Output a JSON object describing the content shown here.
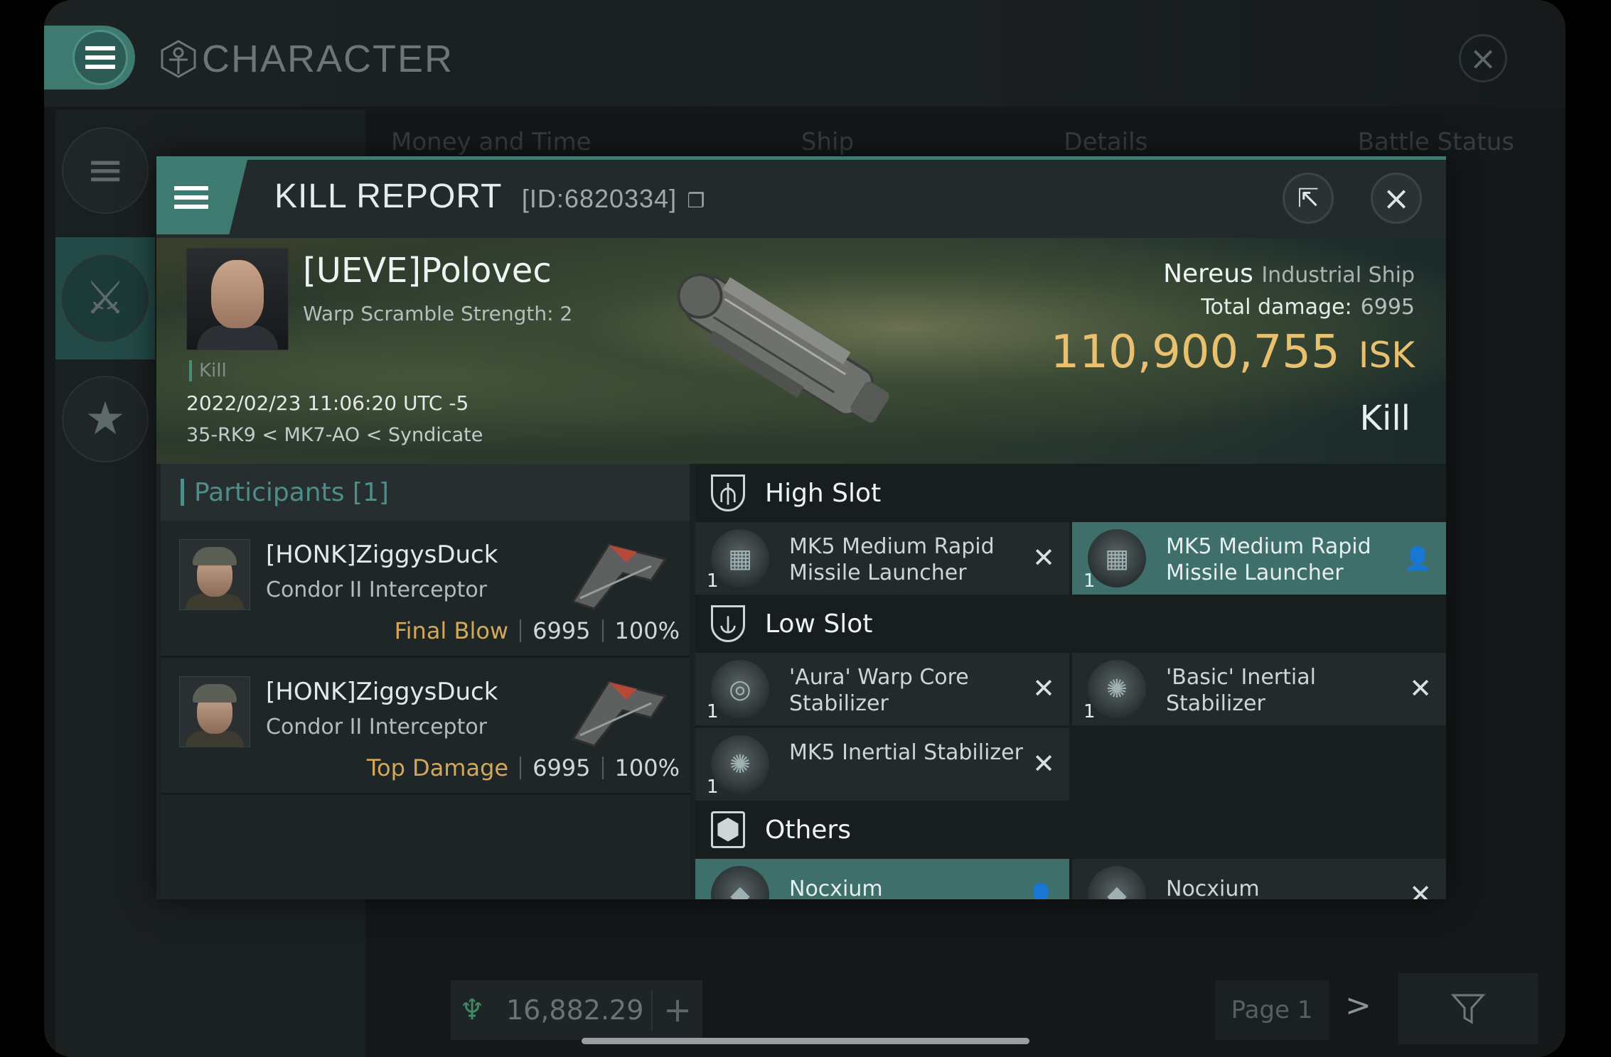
{
  "app": {
    "title": "CHARACTER",
    "tabs": [
      "Money and Time",
      "Ship",
      "Details",
      "Battle Status"
    ],
    "wallet": {
      "value": "16,882.29",
      "plus": "+"
    },
    "page": {
      "label": "Page 1",
      "next": ">"
    }
  },
  "dialog": {
    "title": "KILL REPORT",
    "id": "[ID:6820334]",
    "victim": {
      "name": "[UEVE]Polovec",
      "subtitle": "Warp Scramble Strength: 2",
      "tag": "Kill",
      "date": "2022/02/23 11:06:20 UTC -5",
      "location": "35-RK9 < MK7-AO < Syndicate"
    },
    "ship": {
      "name": "Nereus",
      "class": "Industrial Ship",
      "total_damage_label": "Total damage:",
      "total_damage": "6995",
      "isk_value": "110,900,755",
      "isk_unit": "ISK",
      "result": "Kill"
    },
    "participants": {
      "header": "Participants",
      "count": "[1]",
      "rows": [
        {
          "name": "[HONK]ZiggysDuck",
          "ship": "Condor II Interceptor",
          "tag": "Final Blow",
          "damage": "6995",
          "percent": "100%"
        },
        {
          "name": "[HONK]ZiggysDuck",
          "ship": "Condor II Interceptor",
          "tag": "Top Damage",
          "damage": "6995",
          "percent": "100%"
        }
      ]
    },
    "fitting": {
      "high_slot": {
        "label": "High Slot",
        "items": [
          {
            "qty": "1",
            "name": "MK5 Medium Rapid Missile Launcher",
            "state": "destroyed"
          },
          {
            "qty": "1",
            "name": "MK5 Medium Rapid Missile Launcher",
            "state": "dropped"
          }
        ]
      },
      "low_slot": {
        "label": "Low Slot",
        "items": [
          {
            "qty": "1",
            "name": "'Aura' Warp Core Stabilizer",
            "state": "destroyed"
          },
          {
            "qty": "1",
            "name": "'Basic' Inertial Stabilizer",
            "state": "destroyed"
          },
          {
            "qty": "1",
            "name": "MK5 Inertial Stabilizer",
            "state": "destroyed"
          }
        ]
      },
      "others": {
        "label": "Others",
        "items": [
          {
            "name": "Nocxium",
            "state": "dropped"
          },
          {
            "name": "Nocxium",
            "state": "destroyed"
          }
        ]
      }
    }
  },
  "colors": {
    "accent": "#3e7a70",
    "isk": "#e8c070",
    "final_blow": "#d3a85a"
  },
  "icons": {
    "destroyed": "close-icon",
    "dropped": "person-icon"
  }
}
